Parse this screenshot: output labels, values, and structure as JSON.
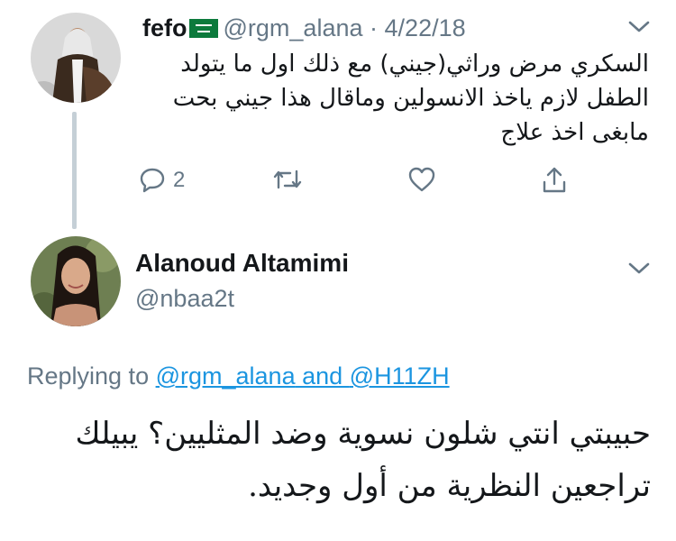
{
  "tweet1": {
    "display_name": "fefo",
    "handle": "@rgm_alana",
    "separator": "·",
    "date": "4/22/18",
    "text": "السكري مرض وراثي(جيني) مع ذلك اول ما يتولد الطفل لازم ياخذ الانسولين وماقال هذا جيني بحت مابغى اخذ علاج",
    "reply_count": "2",
    "icons": [
      "saudi-flag-icon",
      "chevron-down-icon",
      "reply-icon",
      "retweet-icon",
      "like-icon",
      "share-icon"
    ]
  },
  "tweet2": {
    "display_name": "Alanoud Altamimi",
    "handle": "@nbaa2t",
    "replying_prefix": "Replying to ",
    "replying_user1": "@rgm_alana",
    "replying_and": " and ",
    "replying_user2": "@H11ZH",
    "text": "حبيبتي انتي شلون نسوية وضد المثليين؟ يبيلك تراجعين النظرية من أول وجديد."
  },
  "colors": {
    "text": "#14171a",
    "secondary": "#657786",
    "link": "#1b95e0",
    "thread_line": "#c5cfd6",
    "flag_green": "#0c7a3c"
  }
}
